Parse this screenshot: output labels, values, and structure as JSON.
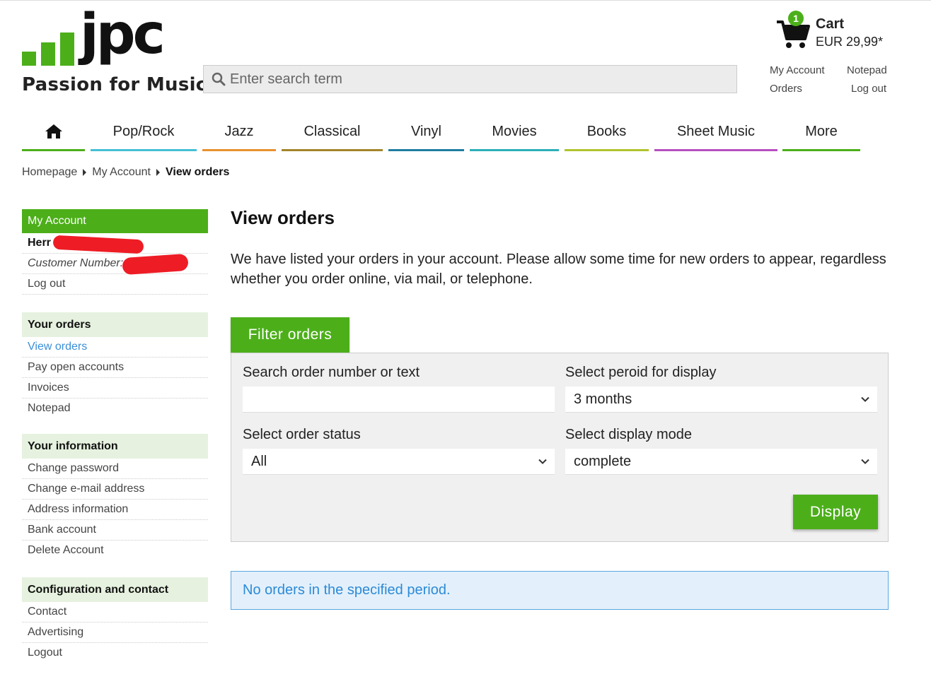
{
  "logo": {
    "letters": "jpc",
    "tagline": "Passion for Music"
  },
  "search": {
    "placeholder": "Enter search term"
  },
  "cart": {
    "count": "1",
    "title": "Cart",
    "price": "EUR 29,99*"
  },
  "account_links": {
    "my_account": "My Account",
    "notepad": "Notepad",
    "orders": "Orders",
    "logout": "Log out"
  },
  "nav": {
    "home_icon": "home-icon",
    "items": [
      {
        "label": "Pop/Rock",
        "color": "#44bfd4"
      },
      {
        "label": "Jazz",
        "color": "#e8912e"
      },
      {
        "label": "Classical",
        "color": "#a3852a"
      },
      {
        "label": "Vinyl",
        "color": "#1e7ea0"
      },
      {
        "label": "Movies",
        "color": "#2ab0b8"
      },
      {
        "label": "Books",
        "color": "#b0c42c"
      },
      {
        "label": "Sheet Music",
        "color": "#b84fc0"
      },
      {
        "label": "More",
        "color": "#4caf1a"
      }
    ],
    "home_color": "#4caf1a"
  },
  "breadcrumb": {
    "home": "Homepage",
    "account": "My Account",
    "current": "View orders"
  },
  "sidebar": {
    "account_title": "My Account",
    "salutation": "Herr",
    "customer_number_label": "Customer Number:",
    "logout": "Log out",
    "orders_title": "Your orders",
    "orders_items": [
      "View orders",
      "Pay open accounts",
      "Invoices",
      "Notepad"
    ],
    "info_title": "Your information",
    "info_items": [
      "Change password",
      "Change e-mail address",
      "Address information",
      "Bank account",
      "Delete Account"
    ],
    "config_title": "Configuration and contact",
    "config_items": [
      "Contact",
      "Advertising",
      "Logout"
    ]
  },
  "main": {
    "title": "View orders",
    "intro": "We have listed your orders in your account. Please allow some time for new orders to appear, regardless whether you order online, via mail, or telephone.",
    "filter_tab": "Filter orders",
    "search_label": "Search order number or text",
    "search_value": "",
    "period_label": "Select peroid for display",
    "period_value": "3 months",
    "status_label": "Select order status",
    "status_value": "All",
    "mode_label": "Select display mode",
    "mode_value": "complete",
    "display_button": "Display",
    "notice": "No orders in the specified period."
  },
  "colors": {
    "brand_green": "#4caf1a",
    "info_blue": "#2d8ad6",
    "redaction": "#ee1c25"
  }
}
